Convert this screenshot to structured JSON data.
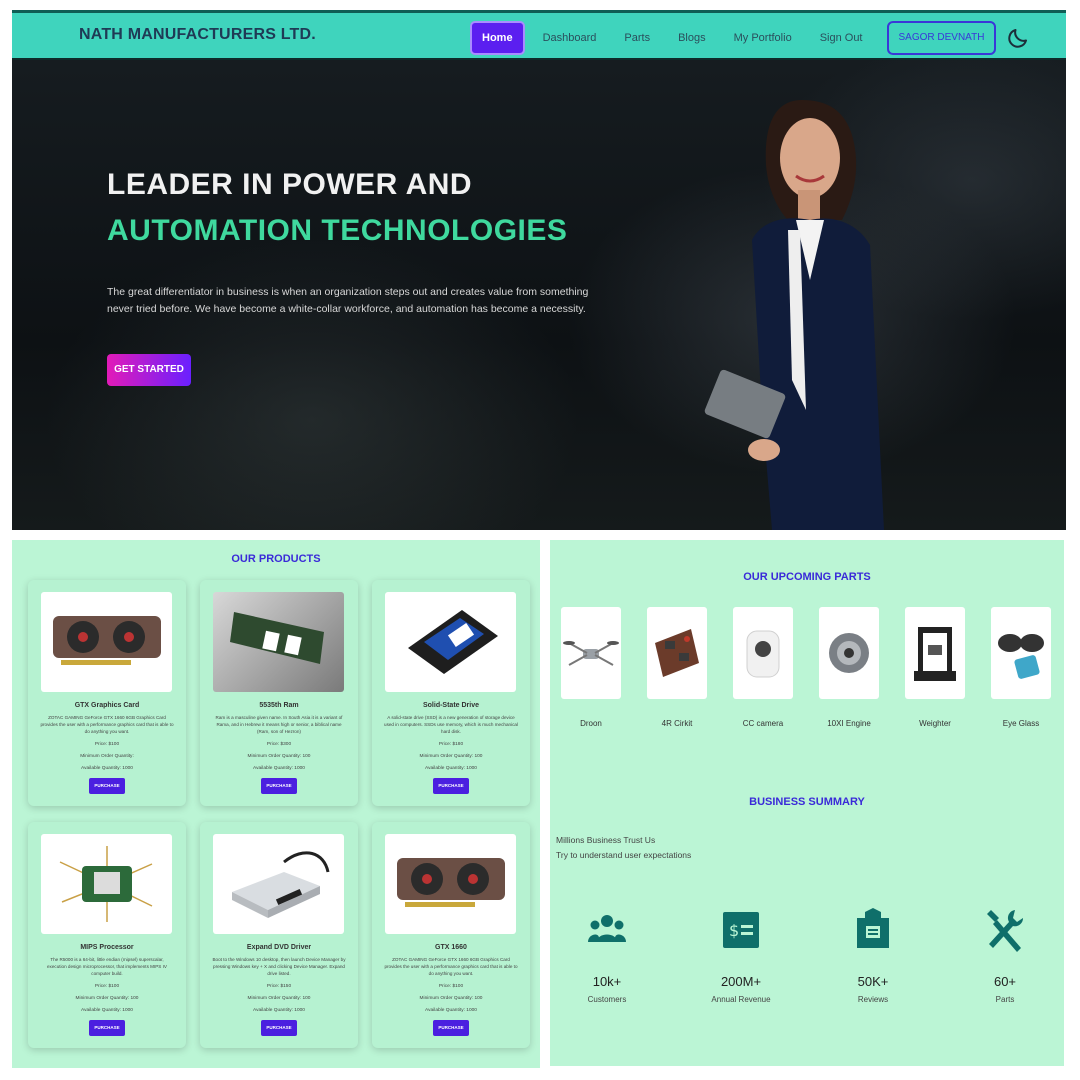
{
  "navbar": {
    "brand": "NATH MANUFACTURERS LTD.",
    "links": [
      "Home",
      "Dashboard",
      "Parts",
      "Blogs",
      "My Portfolio",
      "Sign Out"
    ],
    "user_button": "SAGOR DEVNATH",
    "theme_icon": "moon-icon"
  },
  "hero": {
    "title_line1": "LEADER IN POWER AND",
    "title_line2": "AUTOMATION TECHNOLOGIES",
    "description": "The great differentiator in business is when an organization steps out and creates value from something never tried before. We have become a white-collar workforce, and automation has become a necessity.",
    "cta": "GET STARTED"
  },
  "products": {
    "title": "OUR PRODUCTS",
    "items": [
      {
        "name": "GTX Graphics Card",
        "desc": "ZOTAC GAMING GeForce GTX 1660 6GB Graphics Card provides the user with a performance graphics card that is able to do anything you want.",
        "price": "Price: $100",
        "min_order": "Minimum Order Quantity:",
        "available": "Available Quantity: 1000",
        "button": "PURCHASE"
      },
      {
        "name": "5535th Ram",
        "desc": "Ram is a masculine given name. In South Asia it is a variant of Rama, and in Hebrew it means high or senior, a biblical name (Ram, son of Hezron)",
        "price": "Price: $300",
        "min_order": "Minimum Order Quantity: 100",
        "available": "Available Quantity: 1000",
        "button": "PURCHASE"
      },
      {
        "name": "Solid-State Drive",
        "desc": "A solid-state drive (SSD) is a new generation of storage device used in computers. SSDs use memory, which is much mechanical hard disk.",
        "price": "Price: $180",
        "min_order": "Minimum Order Quantity: 100",
        "available": "Available Quantity: 1000",
        "button": "PURCHASE"
      },
      {
        "name": "MIPS Processor",
        "desc": "The R5000 is a 64-bit, little endian (mipsel) superscalar, execution design microprocessor, that implements MIPS IV computer build.",
        "price": "Price: $100",
        "min_order": "Minimum Order Quantity: 100",
        "available": "Available Quantity: 1000",
        "button": "PURCHASE"
      },
      {
        "name": "Expand DVD Driver",
        "desc": "Boot to the Windows 10 desktop, then launch Device Manager by pressing Windows key + X and clicking Device Manager. Expand drive listed.",
        "price": "Price: $150",
        "min_order": "Minimum Order Quantity: 100",
        "available": "Available Quantity: 1000",
        "button": "PURCHASE"
      },
      {
        "name": "GTX 1660",
        "desc": "ZOTAC GAMING GeForce GTX 1660 6GB Graphics Card provides the user with a performance graphics card that is able to do anything you want.",
        "price": "Price: $100",
        "min_order": "Minimum Order Quantity: 100",
        "available": "Available Quantity: 1000",
        "button": "PURCHASE"
      }
    ]
  },
  "upcoming": {
    "title": "OUR UPCOMING PARTS",
    "items": [
      "Droon",
      "4R Cirkit",
      "CC camera",
      "10XI Engine",
      "Weighter",
      "Eye Glass"
    ]
  },
  "summary": {
    "title": "BUSINESS SUMMARY",
    "line1": "Millions Business Trust Us",
    "line2": "Try to understand user expectations",
    "stats": [
      {
        "value": "10k+",
        "label": "Customers",
        "icon": "users-icon"
      },
      {
        "value": "200M+",
        "label": "Annual Revenue",
        "icon": "money-icon"
      },
      {
        "value": "50K+",
        "label": "Reviews",
        "icon": "reviews-icon"
      },
      {
        "value": "60+",
        "label": "Parts",
        "icon": "tools-icon"
      }
    ]
  },
  "colors": {
    "navbar": "#3fd4bd",
    "accent": "#5b1ff0",
    "hero_green": "#3fd99e",
    "panel": "#bbf5d5",
    "icon": "#0f6f6a"
  }
}
